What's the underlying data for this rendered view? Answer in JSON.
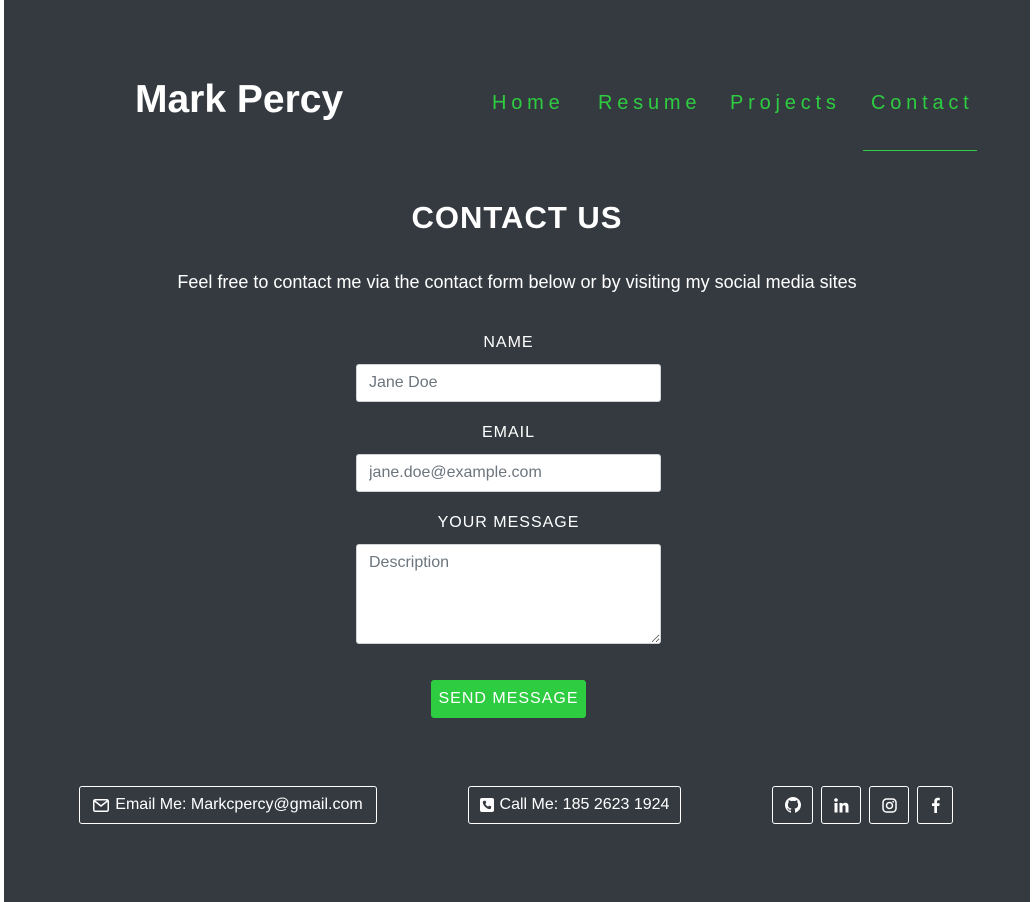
{
  "header": {
    "brand": "Mark Percy",
    "nav": [
      {
        "label": "Home"
      },
      {
        "label": "Resume"
      },
      {
        "label": "Projects"
      },
      {
        "label": "Contact",
        "active": true
      }
    ],
    "accent_color": "#2ecc40"
  },
  "main": {
    "title": "CONTACT US",
    "intro": "Feel free to contact me via the contact form below or by visiting my social media sites",
    "form": {
      "name_label": "NAME",
      "name_placeholder": "Jane Doe",
      "email_label": "EMAIL",
      "email_placeholder": "jane.doe@example.com",
      "message_label": "YOUR MESSAGE",
      "message_placeholder": "Description",
      "submit_label": "SEND MESSAGE"
    }
  },
  "footer": {
    "email_label": "Email Me: Markcpercy@gmail.com",
    "phone_label": "Call Me: 185 2623 1924",
    "social": [
      {
        "icon": "github-icon"
      },
      {
        "icon": "linkedin-icon"
      },
      {
        "icon": "instagram-icon"
      },
      {
        "icon": "facebook-icon"
      }
    ]
  }
}
